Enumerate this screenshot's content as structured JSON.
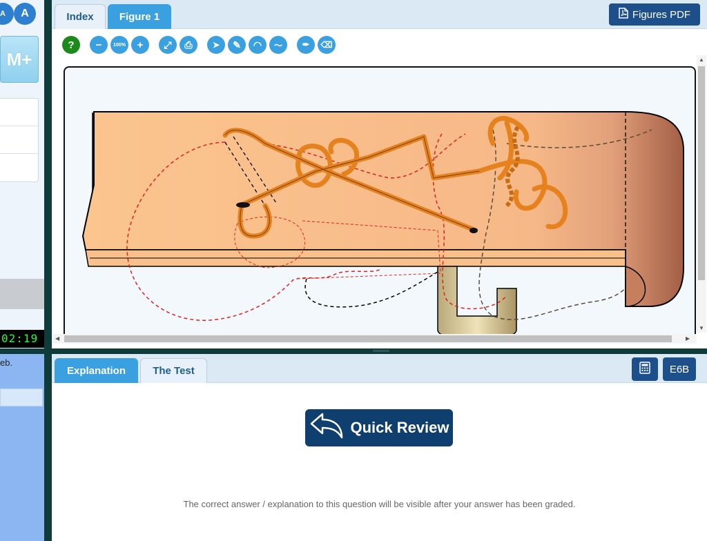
{
  "left": {
    "timer": "02:19",
    "m_plus_label": "M+",
    "fragment_text": "eb.",
    "font_buttons": [
      "A",
      "A"
    ]
  },
  "top": {
    "tabs": [
      {
        "label": "Index",
        "active": false
      },
      {
        "label": "Figure 1",
        "active": true
      }
    ],
    "figures_pdf_label": "Figures PDF",
    "tools": [
      {
        "name": "help-icon",
        "glyph": "?"
      },
      {
        "name": "zoom-out-icon",
        "glyph": "−"
      },
      {
        "name": "zoom-100-icon",
        "glyph": "100%"
      },
      {
        "name": "zoom-in-icon",
        "glyph": "+"
      },
      {
        "name": "fullscreen-icon",
        "glyph": "⤢"
      },
      {
        "name": "print-icon",
        "glyph": "⎙"
      },
      {
        "name": "pointer-icon",
        "glyph": "➤"
      },
      {
        "name": "pencil-icon",
        "glyph": "✎"
      },
      {
        "name": "protractor-icon",
        "glyph": "◠"
      },
      {
        "name": "freehand-icon",
        "glyph": "〜"
      },
      {
        "name": "color-picker-icon",
        "glyph": "✒"
      },
      {
        "name": "eraser-icon",
        "glyph": "⌫"
      }
    ]
  },
  "bottom": {
    "tabs": [
      {
        "label": "Explanation",
        "active": true
      },
      {
        "label": "The Test",
        "active": false
      }
    ],
    "calculator_icon": "calculator-icon",
    "code_label": "E6B",
    "quick_review_label": "Quick Review",
    "explanation_note": "The correct answer / explanation to this question will be visible after your answer has been graded."
  },
  "colors": {
    "accent": "#3aa0e0",
    "dark_button": "#1d4f8a",
    "panel_border": "#0f3b3b"
  }
}
